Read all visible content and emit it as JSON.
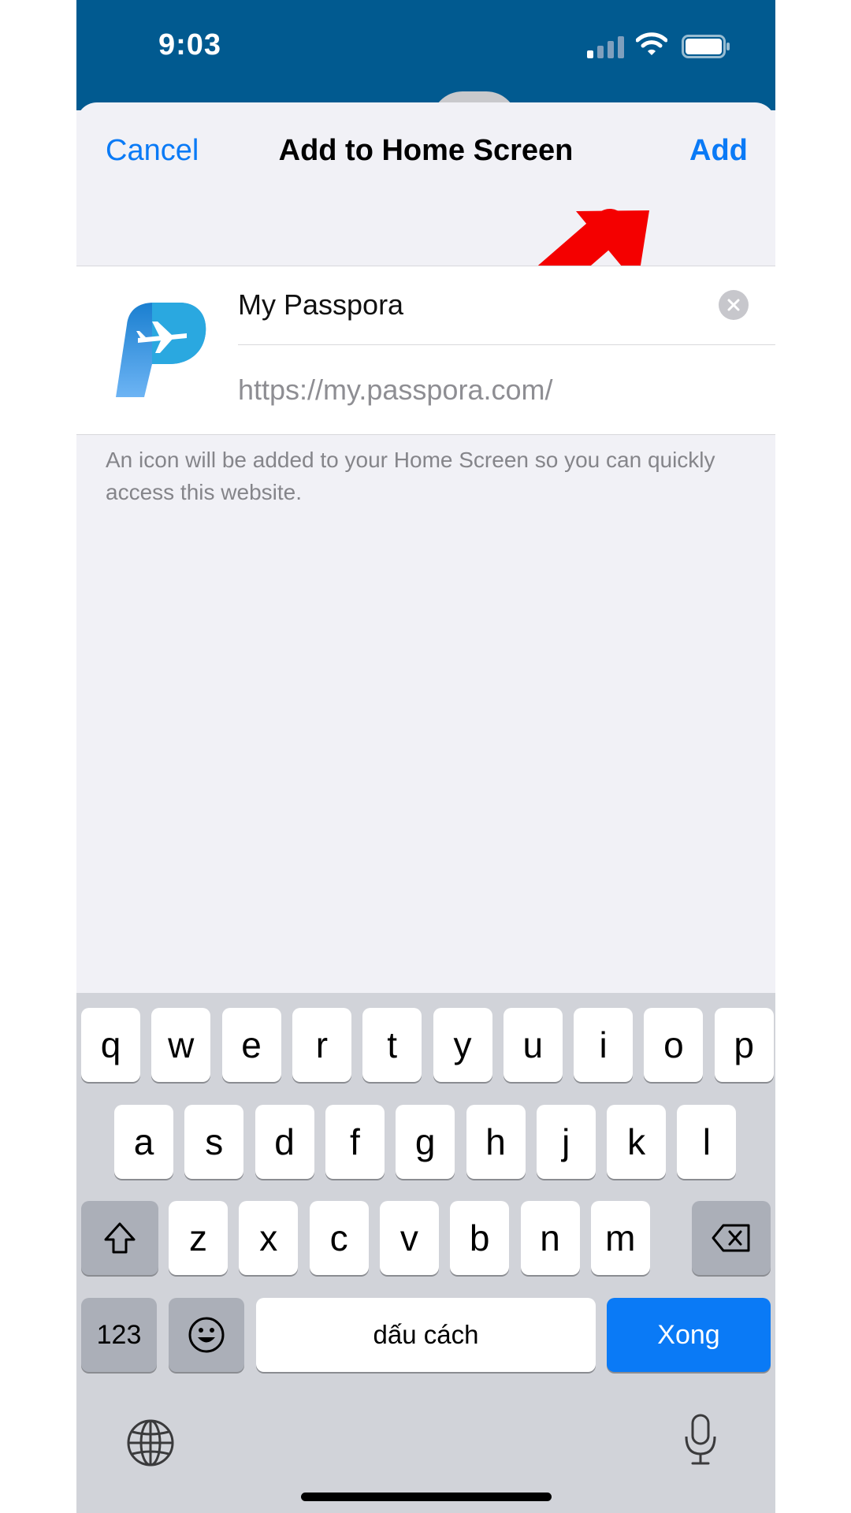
{
  "status_bar": {
    "time": "9:03",
    "icons": [
      "signal-icon",
      "wifi-icon",
      "battery-icon"
    ]
  },
  "sheet": {
    "cancel_label": "Cancel",
    "title": "Add to Home Screen",
    "add_label": "Add",
    "name_value": "My Passpora",
    "url_value": "https://my.passpora.com/",
    "hint": "An icon will be added to your Home Screen so you can quickly access this website."
  },
  "keyboard": {
    "row1": [
      "q",
      "w",
      "e",
      "r",
      "t",
      "y",
      "u",
      "i",
      "o",
      "p"
    ],
    "row2": [
      "a",
      "s",
      "d",
      "f",
      "g",
      "h",
      "j",
      "k",
      "l"
    ],
    "row3": [
      "z",
      "x",
      "c",
      "v",
      "b",
      "n",
      "m"
    ],
    "numbers_label": "123",
    "space_label": "dấu cách",
    "done_label": "Xong"
  },
  "colors": {
    "accent": "#0a7af6",
    "status_bar": "#015a90",
    "keyboard_bg": "#d1d3d9",
    "annotation_arrow": "#f40000"
  }
}
